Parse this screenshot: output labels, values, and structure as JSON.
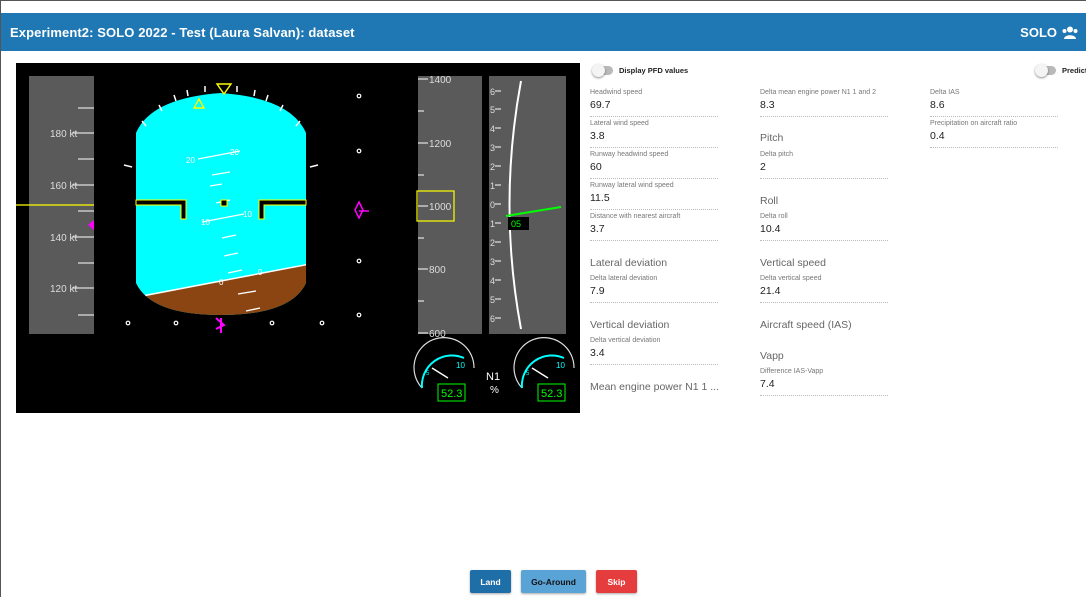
{
  "header": {
    "title": "Experiment2: SOLO 2022 - Test (Laura Salvan): dataset",
    "brand": "SOLO"
  },
  "pfd": {
    "speed_ticks": [
      "180 kt",
      "160 kt",
      "140 kt",
      "120 kt"
    ],
    "pitch_labels_upper": [
      "20",
      "20"
    ],
    "pitch_labels_mid": [
      "10",
      "10"
    ],
    "pitch_labels_lower": [
      "0",
      "0"
    ],
    "altitude_ticks": [
      "1400",
      "1200",
      "1000",
      "800",
      "600"
    ],
    "vs_ticks": [
      "6",
      "5",
      "4",
      "3",
      "2",
      "1",
      "0",
      "1",
      "2",
      "3",
      "4",
      "5",
      "6"
    ],
    "vs_readout": "05",
    "n1_label": "N1",
    "n1_unit": "%",
    "n1_left_value": "52.3",
    "n1_right_value": "52.3",
    "gauge_tick_left": "10",
    "gauge_tick_left_low": "5",
    "gauge_tick_right": "10",
    "gauge_tick_right_low": "5",
    "n1_left_level": 0.523,
    "n1_right_level": 0.523,
    "colors": {
      "sky": "#00ffff",
      "ground": "#8b4513",
      "magenta": "#ff00ff",
      "yellow": "#ffff00",
      "green": "#00ff00"
    }
  },
  "toggles": {
    "display_pfd": "Display PFD values",
    "predict": "Predict"
  },
  "col1": {
    "headwind_speed_label": "Headwind speed",
    "headwind_speed_value": "69.7",
    "lateral_wind_label": "Lateral wind speed",
    "lateral_wind_value": "3.8",
    "runway_headwind_label": "Runway headwind speed",
    "runway_headwind_value": "60",
    "runway_lateral_label": "Runway lateral wind speed",
    "runway_lateral_value": "11.5",
    "distance_label": "Distance with nearest aircraft",
    "distance_value": "3.7",
    "lateral_deviation_title": "Lateral deviation",
    "delta_lateral_label": "Delta lateral deviation",
    "delta_lateral_value": "7.9",
    "vertical_deviation_title": "Vertical deviation",
    "delta_vertical_dev_label": "Delta vertical deviation",
    "delta_vertical_dev_value": "3.4",
    "mean_engine_title": "Mean engine power N1 1 ..."
  },
  "col2": {
    "delta_mean_engine_label": "Delta mean engine power N1 1 and 2",
    "delta_mean_engine_value": "8.3",
    "pitch_title": "Pitch",
    "delta_pitch_label": "Delta pitch",
    "delta_pitch_value": "2",
    "roll_title": "Roll",
    "delta_roll_label": "Delta roll",
    "delta_roll_value": "10.4",
    "vertical_speed_title": "Vertical speed",
    "delta_vertical_speed_label": "Delta vertical speed",
    "delta_vertical_speed_value": "21.4",
    "aircraft_speed_title": "Aircraft speed (IAS)",
    "vapp_title": "Vapp",
    "diff_ias_vapp_label": "Difference IAS-Vapp",
    "diff_ias_vapp_value": "7.4"
  },
  "col3": {
    "delta_ias_label": "Delta IAS",
    "delta_ias_value": "8.6",
    "precip_label": "Precipitation on aircraft ratio",
    "precip_value": "0.4"
  },
  "buttons": {
    "land": "Land",
    "go_around": "Go-Around",
    "skip": "Skip"
  }
}
